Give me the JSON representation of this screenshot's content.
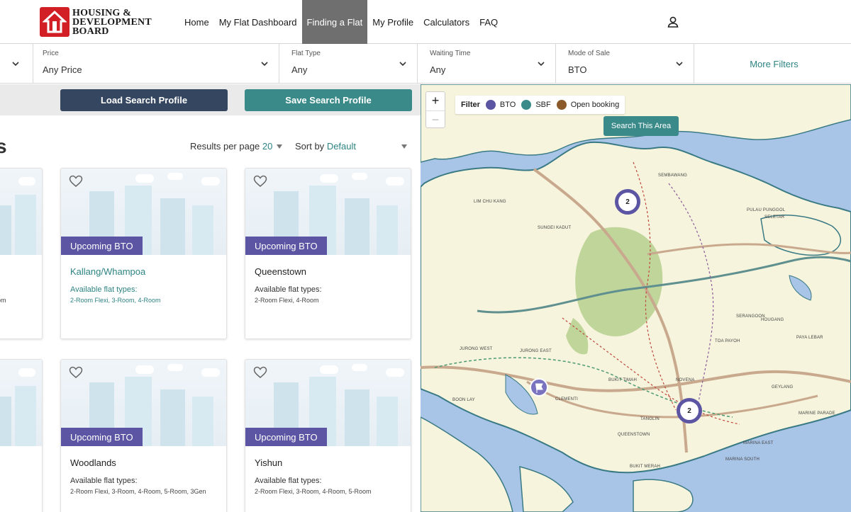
{
  "header": {
    "logo_line1": "HOUSING &",
    "logo_line2": "DEVELOPMENT",
    "logo_line3": "BOARD",
    "nav": [
      {
        "label": "Home"
      },
      {
        "label": "My Flat Dashboard"
      },
      {
        "label": "Finding a Flat",
        "active": true
      },
      {
        "label": "My Profile"
      },
      {
        "label": "Calculators"
      },
      {
        "label": "FAQ"
      }
    ]
  },
  "filters": {
    "price": {
      "label": "Price",
      "value": "Any Price"
    },
    "flat_type": {
      "label": "Flat Type",
      "value": "Any"
    },
    "waiting_time": {
      "label": "Waiting Time",
      "value": "Any"
    },
    "mode_of_sale": {
      "label": "Mode of Sale",
      "value": "BTO"
    },
    "more_filters": "More Filters"
  },
  "profile_buttons": {
    "load": "Load Search Profile",
    "save": "Save Search Profile"
  },
  "results": {
    "heading_fragment": "s",
    "per_page_label": "Results per page",
    "per_page_value": "20",
    "sort_label": "Sort by",
    "sort_value": "Default"
  },
  "cards": [
    {
      "badge": "Upcoming BTO",
      "name": "Kallang/Whampoa",
      "types_label": "Available flat types:",
      "types": "2-Room Flexi, 3-Room, 4-Room",
      "highlight": true
    },
    {
      "badge": "Upcoming BTO",
      "name": "Queenstown",
      "types_label": "Available flat types:",
      "types": "2-Room Flexi, 4-Room",
      "highlight": false
    },
    {
      "badge": "Upcoming BTO",
      "name": "Woodlands",
      "types_label": "Available flat types:",
      "types": "2-Room Flexi, 3-Room, 4-Room, 5-Room, 3Gen",
      "highlight": false
    },
    {
      "badge": "Upcoming BTO",
      "name": "Yishun",
      "types_label": "Available flat types:",
      "types": "2-Room Flexi, 3-Room, 4-Room, 5-Room",
      "highlight": false
    }
  ],
  "partial_card": {
    "fragment": "om"
  },
  "map": {
    "zoom_in": "+",
    "zoom_out": "−",
    "legend_label": "Filter",
    "legend": [
      {
        "label": "BTO",
        "color": "#5b55a3"
      },
      {
        "label": "SBF",
        "color": "#3a8a8a"
      },
      {
        "label": "Open booking",
        "color": "#8a5a2b"
      }
    ],
    "search_area": "Search This Area",
    "clusters": [
      {
        "count": "2"
      },
      {
        "count": "2"
      }
    ],
    "labels": [
      "SEMBAWANG",
      "LIM CHU KANG",
      "SUNGEI KADUT",
      "SELETAR",
      "PULAU PUNGGOL",
      "HOUGANG",
      "SERANGOON",
      "PAYA LEBAR",
      "TOA PAYOH",
      "JURONG WEST",
      "JURONG EAST",
      "BUKIT TIMAH",
      "CLEMENTI",
      "NOVENA",
      "GEYLANG",
      "BOON LAY",
      "TANGLIN",
      "QUEENSTOWN",
      "BUKIT MERAH",
      "MARINA EAST",
      "MARINE PARADE",
      "MARINA SOUTH"
    ]
  }
}
